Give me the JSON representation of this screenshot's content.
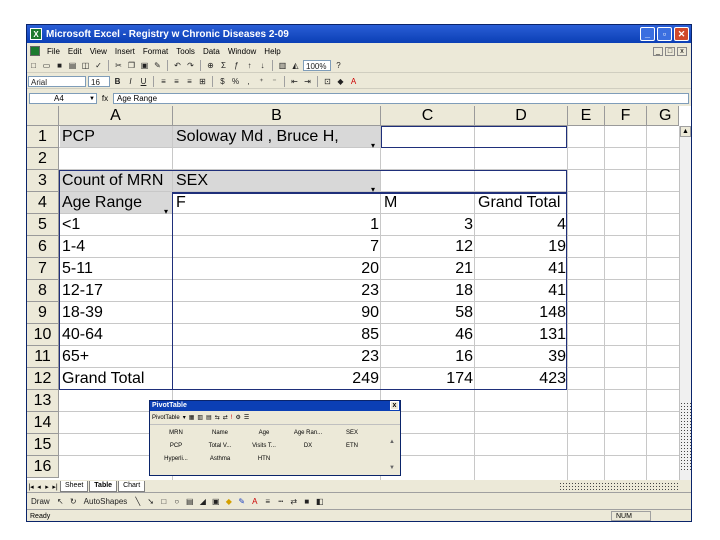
{
  "window": {
    "title": "Microsoft Excel - Registry w Chronic Diseases 2-09",
    "app_icon": "excel-icon",
    "controls": [
      "minimize",
      "restore",
      "close"
    ]
  },
  "menubar": {
    "items": [
      "File",
      "Edit",
      "View",
      "Insert",
      "Format",
      "Tools",
      "Data",
      "Window",
      "Help"
    ],
    "doc_controls": [
      "_",
      "□",
      "x"
    ]
  },
  "toolbar1": {
    "zoom": "100%"
  },
  "toolbar2": {
    "font_name": "Arial",
    "font_size": "16"
  },
  "formula_bar": {
    "name_box": "A4",
    "fx": "fx",
    "content": "Age Range"
  },
  "columns": [
    "A",
    "B",
    "C",
    "D",
    "E",
    "F",
    "G"
  ],
  "rows": [
    "1",
    "2",
    "3",
    "4",
    "5",
    "6",
    "7",
    "8",
    "9",
    "10",
    "11",
    "12",
    "13",
    "14",
    "15",
    "16"
  ],
  "pivot": {
    "page_field_label": "PCP",
    "page_field_value": "Soloway Md , Bruce H,",
    "data_field_label": "Count of MRN",
    "col_field_label": "SEX",
    "row_field_label": "Age Range",
    "col_headers": [
      "F",
      "M",
      "Grand Total"
    ],
    "rows": [
      {
        "label": "<1",
        "F": "1",
        "M": "3",
        "total": "4"
      },
      {
        "label": "1-4",
        "F": "7",
        "M": "12",
        "total": "19"
      },
      {
        "label": "5-11",
        "F": "20",
        "M": "21",
        "total": "41"
      },
      {
        "label": "12-17",
        "F": "23",
        "M": "18",
        "total": "41"
      },
      {
        "label": "18-39",
        "F": "90",
        "M": "58",
        "total": "148"
      },
      {
        "label": "40-64",
        "F": "85",
        "M": "46",
        "total": "131"
      },
      {
        "label": "65+",
        "F": "23",
        "M": "16",
        "total": "39"
      },
      {
        "label": "Grand Total",
        "F": "249",
        "M": "174",
        "total": "423"
      }
    ]
  },
  "pivot_toolbar": {
    "title": "PivotTable",
    "close": "x",
    "menu_label": "PivotTable",
    "fields": [
      "MRN",
      "Name",
      "Age",
      "Age Ran...",
      "SEX",
      "PCP",
      "Total V...",
      "Visits T...",
      "DX",
      "ETN",
      "Hyperli...",
      "Asthma",
      "HTN"
    ]
  },
  "sheet_tabs": {
    "tabs": [
      "Sheet",
      "Table",
      "Chart"
    ]
  },
  "drawing_toolbar": {
    "draw_label": "Draw",
    "autoshapes_label": "AutoShapes"
  },
  "status": {
    "ready": "Ready",
    "num": "NUM"
  }
}
